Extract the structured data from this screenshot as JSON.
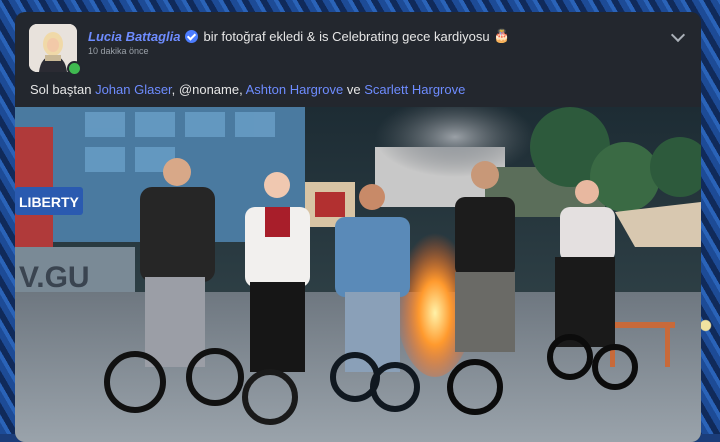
{
  "post": {
    "author": "Lucia Battaglia",
    "action": "bir fotoğraf ekledi & is Celebrating gece kardiyosu",
    "emoji": "🎂",
    "timestamp": "10 dakika önce",
    "caption": {
      "prefix": "Sol baştan",
      "tag1": "Johan Glaser",
      "sep1": ",",
      "mention": "@noname",
      "sep2": ",",
      "tag2": "Ashton Hargrove",
      "conj": "ve",
      "tag3": "Scarlett Hargrove"
    },
    "photo": {
      "sign_text": "LIBERTY",
      "wall_text": "V.GU"
    }
  },
  "icons": {
    "verified": "verified-badge-icon",
    "menu": "chevron-down-icon",
    "emoji": "birthday-cake-icon"
  },
  "colors": {
    "card": "#23272e",
    "link": "#6e8cff",
    "verified": "#4c7dff",
    "online": "#3fb950"
  }
}
